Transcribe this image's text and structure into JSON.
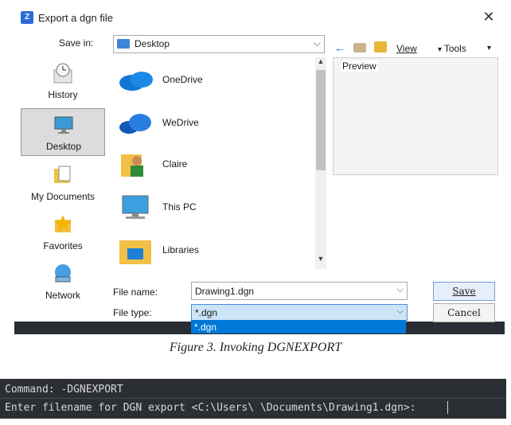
{
  "dialog": {
    "title": "Export a dgn file",
    "close_glyph": "✕",
    "save_in_label": "Save in:",
    "location": "Desktop",
    "view_label": "View",
    "tools_label": "Tools",
    "preview_label": "Preview"
  },
  "nav": {
    "items": [
      {
        "label": "History"
      },
      {
        "label": "Desktop",
        "selected": true
      },
      {
        "label": "My Documents"
      },
      {
        "label": "Favorites"
      },
      {
        "label": "Network"
      }
    ]
  },
  "files": [
    {
      "label": "OneDrive",
      "icon": "onedrive-icon"
    },
    {
      "label": "WeDrive",
      "icon": "wedrive-icon"
    },
    {
      "label": "Claire",
      "icon": "user-folder-icon"
    },
    {
      "label": "This PC",
      "icon": "computer-icon"
    },
    {
      "label": "Libraries",
      "icon": "libraries-icon"
    }
  ],
  "form": {
    "file_name_label": "File name:",
    "file_name_value": "Drawing1.dgn",
    "file_type_label": "File type:",
    "file_type_value": "*.dgn",
    "dropdown_option": "*.dgn",
    "save_label": "Save",
    "cancel_label": "Cancel"
  },
  "caption": "Figure 3. Invoking DGNEXPORT",
  "command": {
    "line1": "Command: -DGNEXPORT",
    "line2": "Enter filename for DGN export <C:\\Users\\ \\Documents\\Drawing1.dgn>:"
  },
  "colors": {
    "accent": "#0078d7",
    "command_bg": "#2b2e33"
  }
}
